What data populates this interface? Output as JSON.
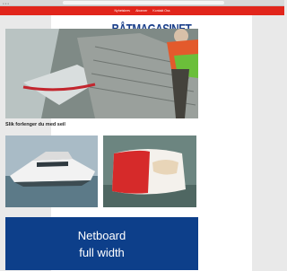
{
  "nav": {
    "items": [
      "Nyhetsbrev",
      "Abonner",
      "Kontakt Oss"
    ]
  },
  "logo": {
    "text": "BÅTMAGASINET"
  },
  "hero": {
    "kicker": "",
    "title": "Slik forlenger du med seil"
  },
  "cards": [
    {
      "caption": ""
    },
    {
      "caption": ""
    }
  ],
  "ad": {
    "line1": "Netboard",
    "line2": "full width"
  },
  "colors": {
    "nav_bg": "#e1251b",
    "logo": "#1a3f8a",
    "ad_bg": "#0d3f8a"
  }
}
